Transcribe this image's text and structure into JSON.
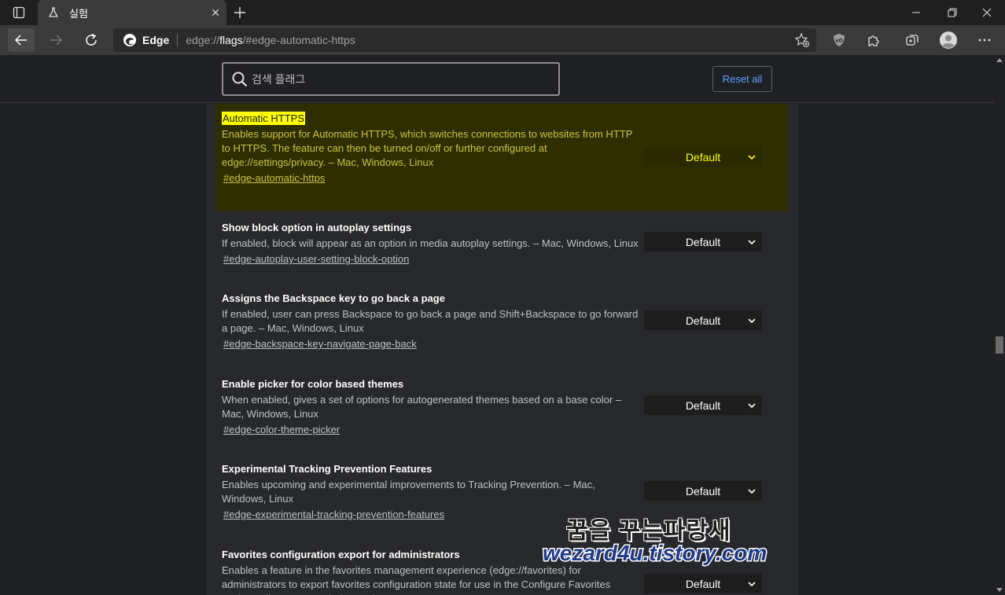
{
  "tab": {
    "title": "실험",
    "close": "✕"
  },
  "address": {
    "brand": "Edge",
    "url_prefix": "edge://",
    "url_bold": "flags",
    "url_suffix": "/#edge-automatic-https"
  },
  "search": {
    "placeholder": "검색 플래그",
    "reset_label": "Reset all"
  },
  "flags": [
    {
      "name": "Automatic HTTPS",
      "desc": "Enables support for Automatic HTTPS, which switches connections to websites from HTTP to HTTPS. The feature can then be turned on/off or further configured at edge://settings/privacy. – Mac, Windows, Linux",
      "anchor": "#edge-automatic-https",
      "value": "Default"
    },
    {
      "name": "Show block option in autoplay settings",
      "desc": "If enabled, block will appear as an option in media autoplay settings. – Mac, Windows, Linux",
      "anchor": "#edge-autoplay-user-setting-block-option",
      "value": "Default"
    },
    {
      "name": "Assigns the Backspace key to go back a page",
      "desc": "If enabled, user can press Backspace to go back a page and Shift+Backspace to go forward a page. – Mac, Windows, Linux",
      "anchor": "#edge-backspace-key-navigate-page-back",
      "value": "Default"
    },
    {
      "name": "Enable picker for color based themes",
      "desc": "When enabled, gives a set of options for autogenerated themes based on a base color – Mac, Windows, Linux",
      "anchor": "#edge-color-theme-picker",
      "value": "Default"
    },
    {
      "name": "Experimental Tracking Prevention Features",
      "desc": "Enables upcoming and experimental improvements to Tracking Prevention. – Mac, Windows, Linux",
      "anchor": "#edge-experimental-tracking-prevention-features",
      "value": "Default"
    },
    {
      "name": "Favorites configuration export for administrators",
      "desc": "Enables a feature in the favorites management experience (edge://favorites) for administrators to export favorites configuration state for use in the Configure Favorites setting policy. – Mac, Windows, Linux",
      "anchor": "",
      "value": "Default"
    }
  ],
  "watermark": {
    "korean": "꿈을 꾸는파랑새",
    "site": "wezard4u.tistory.com"
  },
  "colors": {
    "highlight": "#ffff00",
    "highlight_bg": "#2f2e00",
    "link": "#5aa0ff"
  }
}
